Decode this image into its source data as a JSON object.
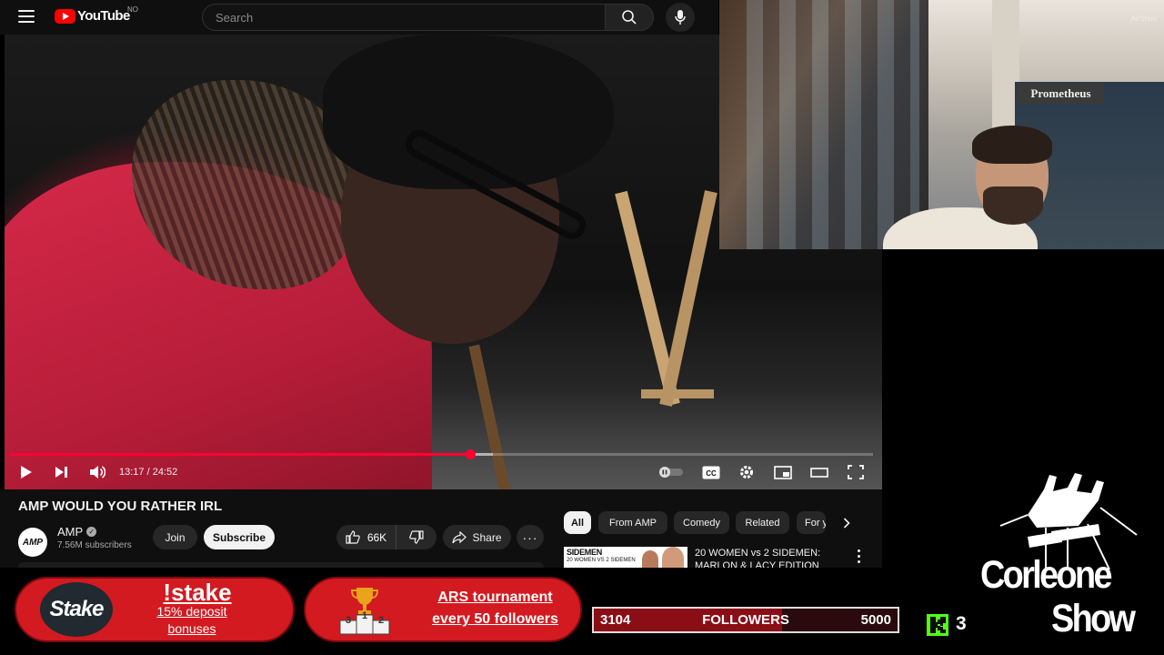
{
  "youtube": {
    "logo_text": "YouTube",
    "country_code": "NO",
    "search_placeholder": "Search"
  },
  "player": {
    "current_time": "13:17",
    "duration": "24:52",
    "time_display": "13:17 / 24:52",
    "progress_fraction": 0.534,
    "buffer_fraction": 0.56,
    "captions_label": "CC"
  },
  "webcam": {
    "store_sign": "Prometheus",
    "watermark": "AirShou"
  },
  "video_info": {
    "title": "AMP WOULD YOU RATHER IRL",
    "channel_name": "AMP",
    "channel_avatar_text": "AMP",
    "subscribers": "7.56M subscribers",
    "join_label": "Join",
    "subscribe_label": "Subscribe",
    "likes": "66K",
    "share_label": "Share"
  },
  "chips": [
    "All",
    "From AMP",
    "Comedy",
    "Related",
    "For you"
  ],
  "recommendation": {
    "thumb_brand": "SIDEMEN",
    "thumb_caption": "20 WOMEN VS 2 SIDEMEN",
    "title": "20 WOMEN vs 2 SIDEMEN: MARLON & LACY EDITION"
  },
  "overlay": {
    "stake_logo": "Stake",
    "stake_command": "!stake",
    "stake_line1": "15% deposit",
    "stake_line2": "bonuses",
    "ars_line1": "ARS tournament",
    "ars_line2": "every 50 followers",
    "podium_digits": [
      "3",
      "1",
      "2"
    ],
    "followers_current": "3104",
    "followers_label": "FOLLOWERS",
    "followers_goal": "5000",
    "followers_fraction": 0.6208,
    "kick_count": "3",
    "brand_line1": "Corleone",
    "brand_line2": "Show"
  },
  "colors": {
    "youtube_red": "#ff0000",
    "progress_red": "#ff0033",
    "promo_red": "#d31a20",
    "kick_green": "#53fc18"
  }
}
